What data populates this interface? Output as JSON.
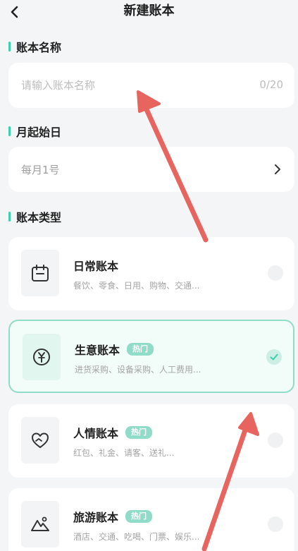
{
  "header": {
    "title": "新建账本"
  },
  "name_section": {
    "label": "账本名称",
    "placeholder": "请输入账本名称",
    "counter": "0/20"
  },
  "start_day_section": {
    "label": "月起始日",
    "value": "每月1号"
  },
  "type_section": {
    "label": "账本类型",
    "hot_label": "热门",
    "items": [
      {
        "name": "日常账本",
        "desc": "餐饮、零食、日用、购物、交通...",
        "selected": false,
        "icon": "calendar-icon"
      },
      {
        "name": "生意账本",
        "desc": "进货采购、设备采购、人工费用...",
        "selected": true,
        "icon": "yen-icon"
      },
      {
        "name": "人情账本",
        "desc": "红包、礼金、请客、送礼...",
        "selected": false,
        "icon": "heart-hand-icon"
      },
      {
        "name": "旅游账本",
        "desc": "酒店、交通、吃喝、门票、娱乐...",
        "selected": false,
        "icon": "mountain-icon"
      }
    ]
  },
  "colors": {
    "accent": "#3ccfae",
    "annotation_arrow": "#e8655f"
  }
}
